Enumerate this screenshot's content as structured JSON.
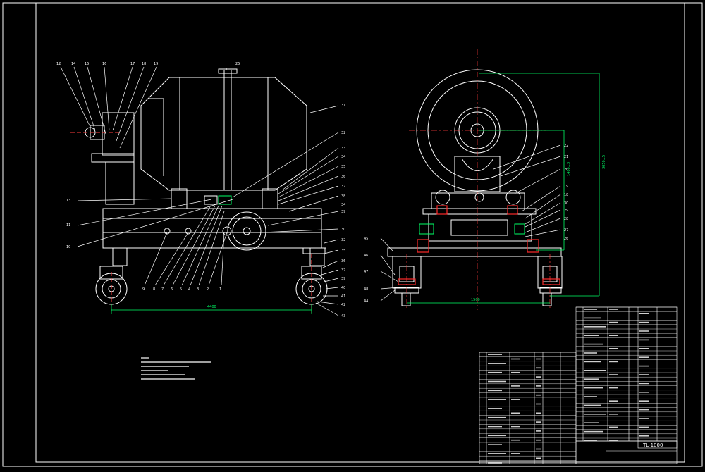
{
  "drawing": {
    "colors": {
      "background": "#000000",
      "outline": "#ffffff",
      "center_line": "#ff3b3b",
      "dimension": "#00ff66",
      "highlight_red": "#ff2a2a",
      "callout_text": "#ffffff"
    },
    "side_view_callouts_top": [
      "12",
      "14",
      "15",
      "16",
      "17",
      "18",
      "19"
    ],
    "side_view_top_label": "25",
    "side_view_callouts_right": [
      "31",
      "32",
      "33",
      "34",
      "35",
      "36",
      "37",
      "38",
      "39",
      "30",
      "32",
      "34"
    ],
    "side_view_callouts_left": [
      "13",
      "11",
      "10"
    ],
    "side_view_callouts_bottom": [
      "9",
      "8",
      "7",
      "6",
      "5",
      "4",
      "3",
      "2",
      "1"
    ],
    "side_view_callouts_wheel_right": [
      "35",
      "36",
      "37",
      "39",
      "40",
      "41",
      "42",
      "43"
    ],
    "side_view_dimension": "4400",
    "front_view_callouts_right": [
      "22",
      "21",
      "20",
      "19",
      "18",
      "30",
      "29",
      "28",
      "27",
      "26"
    ],
    "front_view_callouts_left": [
      "45",
      "46",
      "47",
      "48",
      "44"
    ],
    "front_view_dimension_h": "1500",
    "front_view_dimension_v1": "1400±3",
    "front_view_dimension_v2": "3050±5",
    "title_code": "TL-1000"
  }
}
